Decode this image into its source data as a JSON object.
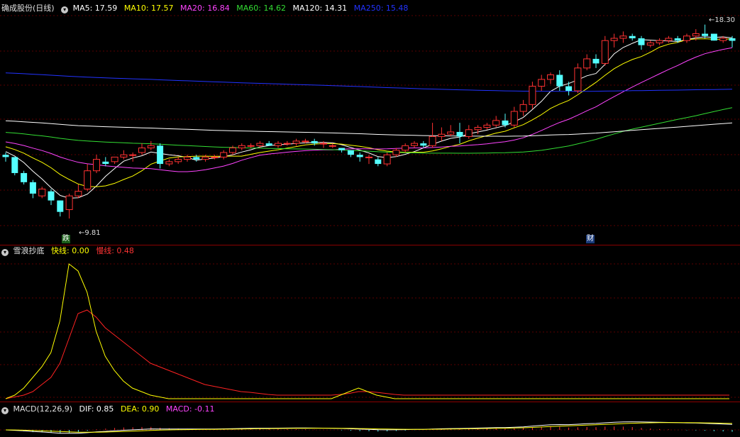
{
  "main": {
    "title": "确成股份(日线)",
    "indicators": [
      {
        "label": "MA5: 17.59",
        "color": "#ffffff"
      },
      {
        "label": "MA10: 17.57",
        "color": "#ffff00"
      },
      {
        "label": "MA20: 16.84",
        "color": "#ff44ff"
      },
      {
        "label": "MA60: 14.62",
        "color": "#33dd33"
      },
      {
        "label": "MA120: 14.31",
        "color": "#ffffff"
      },
      {
        "label": "MA250: 15.48",
        "color": "#2233ff"
      }
    ],
    "high_label": "18.30",
    "low_label": "9.81",
    "marker_left": "跌",
    "marker_right": "财"
  },
  "panel2": {
    "title": "雪浪抄底",
    "fast_label": "快线: 0.00",
    "slow_label": "慢线: 0.48",
    "fast_color": "#ffff00",
    "slow_color": "#ff2222"
  },
  "panel3": {
    "title": "MACD(12,26,9)",
    "dif_label": "DIF: 0.85",
    "dea_label": "DEA: 0.90",
    "macd_label": "MACD: -0.11",
    "dif_color": "#ffffff",
    "dea_color": "#ffff00",
    "macd_color": "#ff44ff"
  },
  "chart_data": {
    "type": "candlestick",
    "price_range": [
      9.81,
      18.3
    ],
    "candles": [
      [
        12.6,
        12.7,
        12.3,
        12.5
      ],
      [
        12.5,
        12.5,
        11.7,
        11.8
      ],
      [
        11.8,
        11.9,
        11.3,
        11.4
      ],
      [
        11.4,
        11.5,
        10.7,
        10.9
      ],
      [
        10.8,
        11.2,
        10.7,
        11.1
      ],
      [
        11.0,
        11.1,
        10.4,
        10.6
      ],
      [
        10.6,
        10.6,
        9.9,
        10.1
      ],
      [
        10.2,
        10.9,
        9.81,
        10.8
      ],
      [
        10.8,
        11.3,
        10.7,
        11.0
      ],
      [
        11.1,
        12.2,
        11.0,
        11.9
      ],
      [
        11.9,
        12.6,
        11.8,
        12.4
      ],
      [
        12.3,
        12.5,
        12.1,
        12.2
      ],
      [
        12.3,
        12.5,
        12.2,
        12.5
      ],
      [
        12.5,
        12.8,
        12.4,
        12.6
      ],
      [
        12.6,
        12.7,
        12.3,
        12.6
      ],
      [
        12.7,
        13.1,
        12.6,
        12.9
      ],
      [
        12.9,
        13.2,
        12.8,
        13.0
      ],
      [
        13.0,
        13.1,
        12.0,
        12.2
      ],
      [
        12.2,
        12.4,
        12.1,
        12.3
      ],
      [
        12.3,
        12.5,
        12.2,
        12.4
      ],
      [
        12.4,
        12.6,
        12.3,
        12.5
      ],
      [
        12.5,
        12.6,
        12.3,
        12.4
      ],
      [
        12.4,
        12.6,
        12.3,
        12.5
      ],
      [
        12.5,
        12.6,
        12.4,
        12.5
      ],
      [
        12.5,
        12.8,
        12.4,
        12.7
      ],
      [
        12.7,
        13.0,
        12.6,
        12.9
      ],
      [
        12.9,
        13.1,
        12.8,
        13.0
      ],
      [
        13.0,
        13.1,
        12.9,
        13.0
      ],
      [
        13.0,
        13.2,
        12.9,
        13.1
      ],
      [
        13.1,
        13.2,
        13.0,
        13.0
      ],
      [
        13.0,
        13.2,
        12.9,
        13.1
      ],
      [
        13.1,
        13.2,
        13.0,
        13.1
      ],
      [
        13.1,
        13.3,
        13.0,
        13.2
      ],
      [
        13.2,
        13.3,
        13.1,
        13.2
      ],
      [
        13.2,
        13.3,
        13.0,
        13.1
      ],
      [
        13.1,
        13.2,
        12.9,
        13.1
      ],
      [
        13.0,
        13.1,
        12.9,
        13.0
      ],
      [
        12.9,
        12.9,
        12.7,
        12.8
      ],
      [
        12.8,
        12.8,
        12.5,
        12.6
      ],
      [
        12.6,
        12.7,
        12.3,
        12.5
      ],
      [
        12.5,
        12.6,
        12.2,
        12.5
      ],
      [
        12.4,
        12.5,
        12.1,
        12.2
      ],
      [
        12.2,
        12.7,
        12.1,
        12.6
      ],
      [
        12.6,
        12.9,
        12.5,
        12.8
      ],
      [
        12.8,
        13.1,
        12.7,
        13.0
      ],
      [
        13.0,
        13.2,
        12.9,
        13.1
      ],
      [
        13.1,
        13.2,
        12.9,
        13.0
      ],
      [
        13.0,
        14.0,
        12.9,
        13.4
      ],
      [
        13.4,
        13.8,
        13.2,
        13.5
      ],
      [
        13.5,
        13.9,
        13.4,
        13.6
      ],
      [
        13.6,
        14.0,
        13.1,
        13.4
      ],
      [
        13.4,
        13.9,
        13.3,
        13.7
      ],
      [
        13.7,
        13.9,
        13.5,
        13.8
      ],
      [
        13.8,
        14.0,
        13.7,
        13.9
      ],
      [
        13.9,
        14.3,
        13.8,
        14.1
      ],
      [
        14.1,
        14.4,
        13.8,
        13.9
      ],
      [
        13.9,
        14.7,
        13.8,
        14.5
      ],
      [
        14.5,
        15.0,
        14.3,
        14.8
      ],
      [
        14.8,
        15.8,
        14.6,
        15.6
      ],
      [
        15.6,
        16.1,
        15.4,
        15.9
      ],
      [
        15.9,
        16.2,
        15.7,
        16.1
      ],
      [
        16.1,
        16.3,
        15.4,
        15.6
      ],
      [
        15.6,
        15.8,
        15.2,
        15.4
      ],
      [
        15.4,
        16.6,
        15.3,
        16.4
      ],
      [
        16.4,
        17.0,
        16.3,
        16.8
      ],
      [
        16.8,
        17.0,
        16.4,
        16.6
      ],
      [
        16.6,
        17.8,
        16.5,
        17.6
      ],
      [
        17.6,
        17.9,
        17.3,
        17.7
      ],
      [
        17.7,
        18.0,
        17.5,
        17.8
      ],
      [
        17.8,
        17.9,
        17.6,
        17.7
      ],
      [
        17.7,
        17.8,
        17.2,
        17.4
      ],
      [
        17.4,
        17.6,
        17.3,
        17.5
      ],
      [
        17.5,
        17.7,
        17.4,
        17.6
      ],
      [
        17.6,
        17.8,
        17.5,
        17.7
      ],
      [
        17.7,
        17.8,
        17.5,
        17.6
      ],
      [
        17.6,
        17.9,
        17.5,
        17.8
      ],
      [
        17.8,
        18.1,
        17.6,
        17.9
      ],
      [
        17.9,
        18.3,
        17.7,
        17.8
      ],
      [
        17.9,
        17.9,
        17.6,
        17.6
      ],
      [
        17.6,
        17.8,
        17.5,
        17.7
      ],
      [
        17.7,
        17.8,
        17.3,
        17.59
      ]
    ],
    "ma_colors": {
      "ma5": "#ffffff",
      "ma10": "#ffff00",
      "ma20": "#ff44ff",
      "ma60": "#33dd33",
      "ma120": "#ffffff",
      "ma250": "#2233ff"
    },
    "fast_line": [
      0.0,
      0.1,
      0.3,
      0.6,
      0.9,
      1.3,
      2.2,
      3.8,
      3.6,
      3.0,
      1.9,
      1.2,
      0.8,
      0.5,
      0.3,
      0.2,
      0.1,
      0.05,
      0.0,
      0.0,
      0.0,
      0.0,
      0.0,
      0.0,
      0.0,
      0.0,
      0.0,
      0.0,
      0.0,
      0.0,
      0.0,
      0.0,
      0.0,
      0.0,
      0.0,
      0.0,
      0.0,
      0.1,
      0.2,
      0.3,
      0.2,
      0.1,
      0.05,
      0.0,
      0.0,
      0.0,
      0.0,
      0.0,
      0.0,
      0.0,
      0.0,
      0.0,
      0.0,
      0.0,
      0.0,
      0.0,
      0.0,
      0.0,
      0.0,
      0.0,
      0.0,
      0.0,
      0.0,
      0.0,
      0.0,
      0.0,
      0.0,
      0.0,
      0.0,
      0.0,
      0.0,
      0.0,
      0.0,
      0.0,
      0.0,
      0.0,
      0.0,
      0.0,
      0.0,
      0.0,
      0.0
    ],
    "slow_line": [
      0.0,
      0.05,
      0.1,
      0.2,
      0.4,
      0.6,
      1.0,
      1.7,
      2.4,
      2.5,
      2.3,
      2.0,
      1.8,
      1.6,
      1.4,
      1.2,
      1.0,
      0.9,
      0.8,
      0.7,
      0.6,
      0.5,
      0.4,
      0.35,
      0.3,
      0.25,
      0.2,
      0.18,
      0.15,
      0.12,
      0.1,
      0.1,
      0.1,
      0.1,
      0.1,
      0.1,
      0.1,
      0.12,
      0.15,
      0.2,
      0.2,
      0.18,
      0.15,
      0.12,
      0.1,
      0.1,
      0.1,
      0.1,
      0.1,
      0.1,
      0.1,
      0.1,
      0.1,
      0.1,
      0.1,
      0.1,
      0.1,
      0.1,
      0.1,
      0.1,
      0.1,
      0.1,
      0.1,
      0.1,
      0.1,
      0.1,
      0.1,
      0.1,
      0.1,
      0.1,
      0.1,
      0.1,
      0.1,
      0.1,
      0.1,
      0.1,
      0.1,
      0.1,
      0.1,
      0.1,
      0.1
    ]
  }
}
